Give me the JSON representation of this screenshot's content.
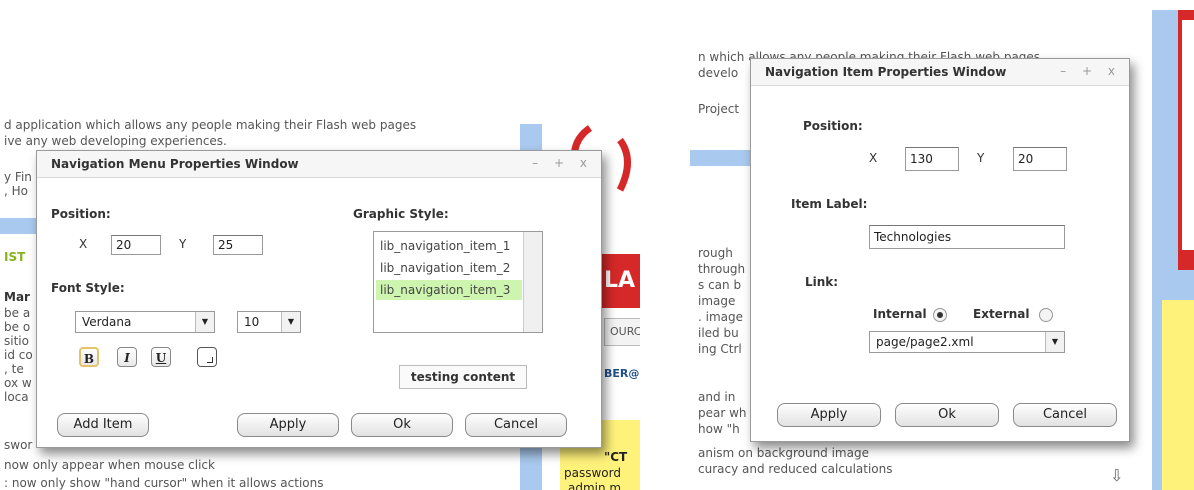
{
  "left": {
    "background_lines": [
      "d application which allows any people making their Flash web pages",
      "ive any web developing experiences."
    ],
    "side_fragments": [
      "y Fin",
      ", Ho",
      "IST",
      "Mar",
      "be a",
      "be o",
      "sitio",
      "id co",
      ", te",
      "ox w",
      " loca",
      "swor"
    ],
    "bottom_lines": [
      "now only appear when mouse click",
      ": now only show \"hand cursor\" when it allows actions"
    ],
    "right_fragments": {
      "letters": "LA",
      "source": "OURC",
      "ber": "BER@",
      "ctr": "\"CT",
      "password": "password",
      "admin": "admin m"
    },
    "window": {
      "title": "Navigation Menu Properties Window",
      "controls": {
        "minimize": "–",
        "maximize": "+",
        "close": "x"
      },
      "position_label": "Position:",
      "x_label": "X",
      "x_value": "20",
      "y_label": "Y",
      "y_value": "25",
      "font_style_label": "Font Style:",
      "font_family": "Verdana",
      "font_size": "10",
      "bold": "B",
      "italic": "I",
      "underline": "U",
      "graphic_style_label": "Graphic Style:",
      "graphic_items": [
        "lib_navigation_item_1",
        "lib_navigation_item_2",
        "lib_navigation_item_3"
      ],
      "selected_graphic": 2,
      "preview_text": "testing content",
      "add_item": "Add Item",
      "apply": "Apply",
      "ok": "Ok",
      "cancel": "Cancel"
    }
  },
  "right": {
    "background_lines": [
      "n which allows any people making their Flash web pages",
      "develo"
    ],
    "side_fragments": [
      "Project",
      "rough",
      "through",
      "s can b",
      " image",
      ". image",
      "iled bu",
      "ing Ctrl",
      "and in",
      "pear wh",
      "how \"h"
    ],
    "bottom_lines": [
      "anism on background image",
      "curacy and reduced calculations"
    ],
    "window": {
      "title": "Navigation Item Properties Window",
      "controls": {
        "minimize": "–",
        "maximize": "+",
        "close": "x"
      },
      "position_label": "Position:",
      "x_label": "X",
      "x_value": "130",
      "y_label": "Y",
      "y_value": "20",
      "item_label_label": "Item Label:",
      "item_label_value": "Technologies",
      "link_label": "Link:",
      "internal_label": "Internal",
      "external_label": "External",
      "link_type": "Internal",
      "link_value": "page/page2.xml",
      "apply": "Apply",
      "ok": "Ok",
      "cancel": "Cancel"
    }
  },
  "colors": {
    "accent_blue": "#a9c9ee",
    "logo_red": "#d62828",
    "note_yellow": "#fff27a",
    "selected_green": "#cdf5b0",
    "heading_green": "#8ab31b"
  },
  "icons": {
    "scroll_down": "⇩"
  }
}
